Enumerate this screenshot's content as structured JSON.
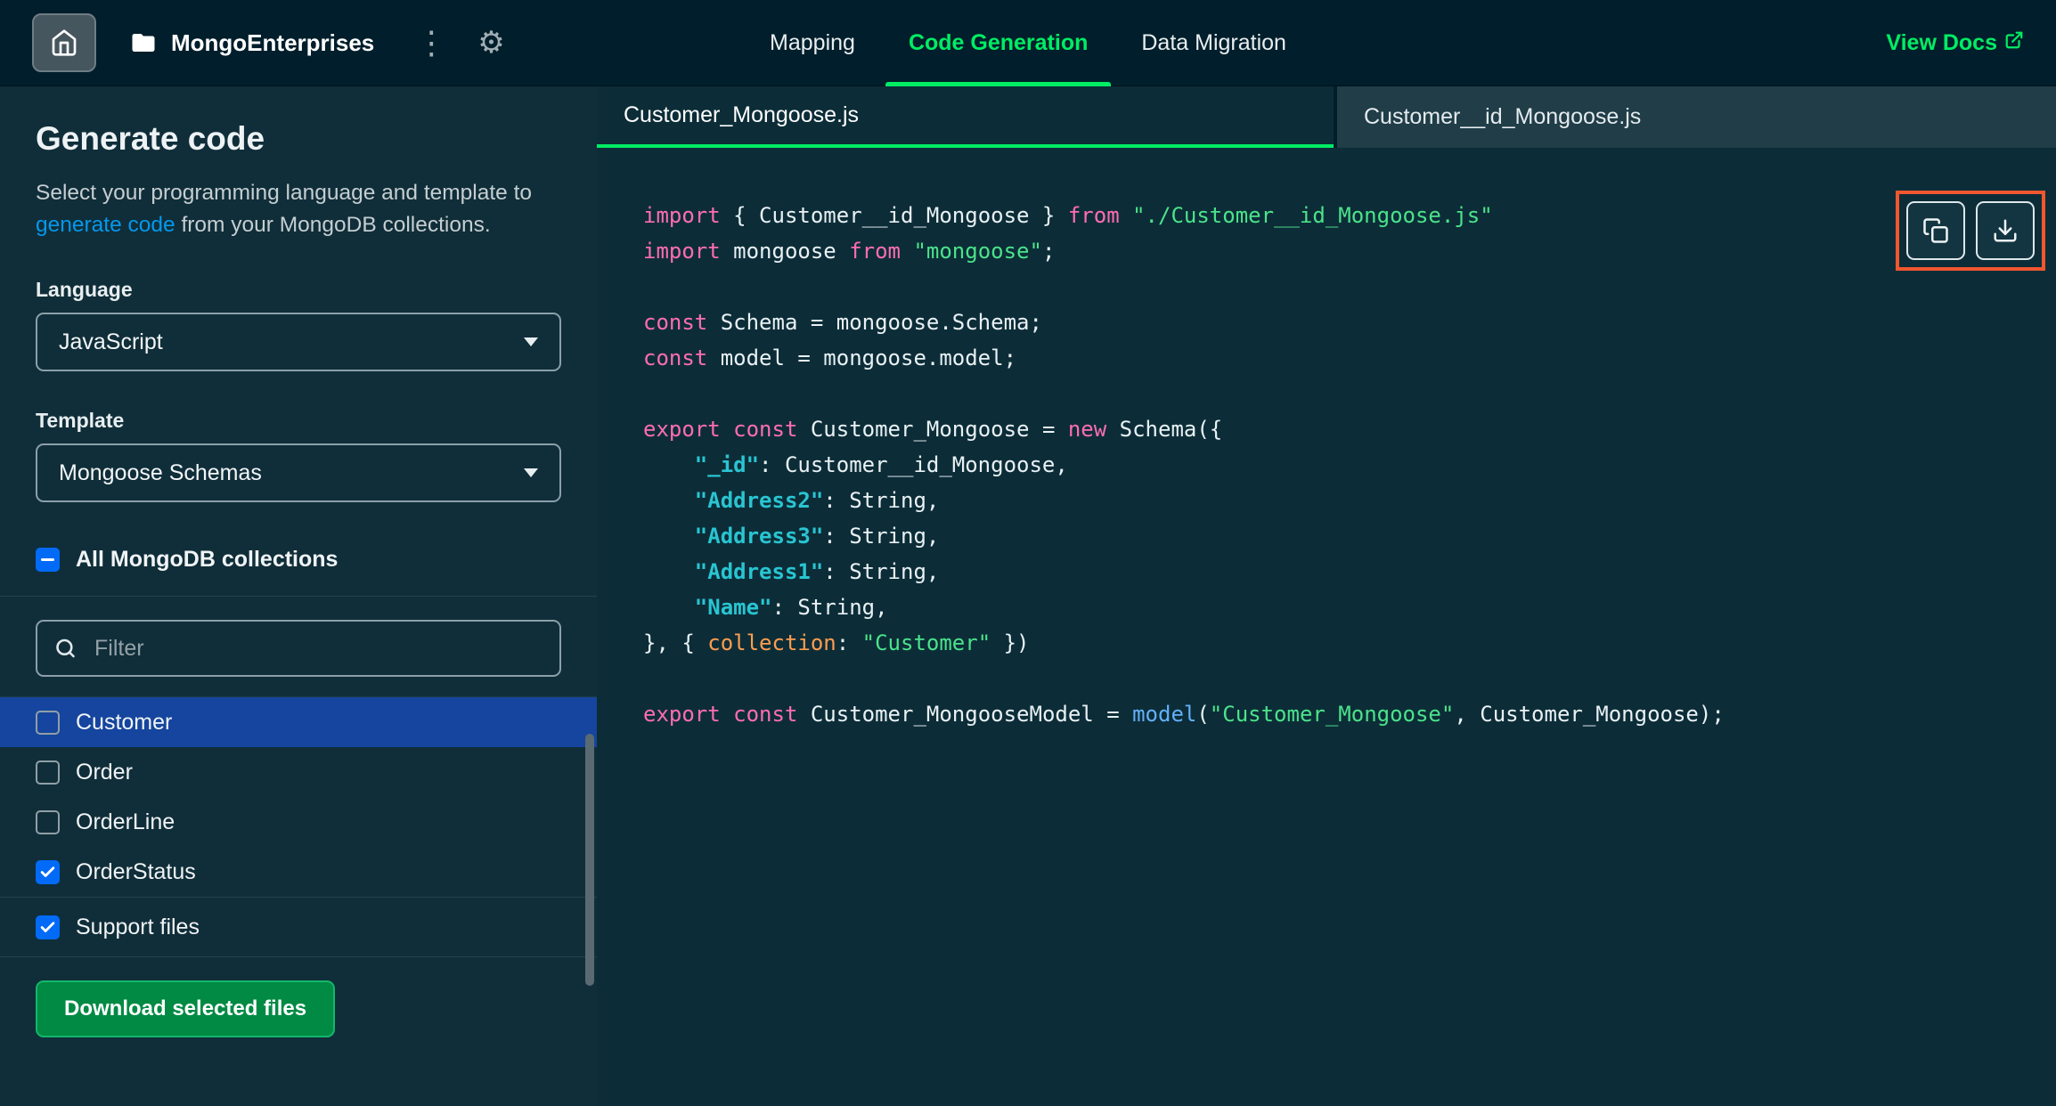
{
  "topbar": {
    "project_name": "MongoEnterprises",
    "tabs": [
      {
        "label": "Mapping",
        "active": false
      },
      {
        "label": "Code Generation",
        "active": true
      },
      {
        "label": "Data Migration",
        "active": false
      }
    ],
    "view_docs_label": "View Docs"
  },
  "sidebar": {
    "title": "Generate code",
    "description_prefix": "Select your programming language and template to ",
    "description_link": "generate code",
    "description_suffix": " from your MongoDB collections.",
    "language_label": "Language",
    "language_value": "JavaScript",
    "template_label": "Template",
    "template_value": "Mongoose Schemas",
    "all_collections_label": "All MongoDB collections",
    "filter_placeholder": "Filter",
    "collections": [
      {
        "name": "Customer",
        "checked": false,
        "selected": true
      },
      {
        "name": "Order",
        "checked": false,
        "selected": false
      },
      {
        "name": "OrderLine",
        "checked": false,
        "selected": false
      },
      {
        "name": "OrderStatus",
        "checked": true,
        "selected": false
      }
    ],
    "support_files": {
      "label": "Support files",
      "checked": true
    },
    "download_button_label": "Download selected files"
  },
  "editor": {
    "tabs": [
      {
        "label": "Customer_Mongoose.js",
        "active": true
      },
      {
        "label": "Customer__id_Mongoose.js",
        "active": false
      }
    ],
    "code_lines": [
      [
        {
          "t": "import",
          "c": "kw"
        },
        {
          "t": " { Customer__id_Mongoose } ",
          "c": "pl"
        },
        {
          "t": "from",
          "c": "kw"
        },
        {
          "t": " ",
          "c": "pl"
        },
        {
          "t": "\"./Customer__id_Mongoose.js\"",
          "c": "str"
        }
      ],
      [
        {
          "t": "import",
          "c": "kw"
        },
        {
          "t": " mongoose ",
          "c": "pl"
        },
        {
          "t": "from",
          "c": "kw"
        },
        {
          "t": " ",
          "c": "pl"
        },
        {
          "t": "\"mongoose\"",
          "c": "str"
        },
        {
          "t": ";",
          "c": "pl"
        }
      ],
      [],
      [
        {
          "t": "const",
          "c": "kw"
        },
        {
          "t": " Schema = mongoose.Schema;",
          "c": "pl"
        }
      ],
      [
        {
          "t": "const",
          "c": "kw"
        },
        {
          "t": " model = mongoose.model;",
          "c": "pl"
        }
      ],
      [],
      [
        {
          "t": "export",
          "c": "kw"
        },
        {
          "t": " ",
          "c": "pl"
        },
        {
          "t": "const",
          "c": "kw"
        },
        {
          "t": " Customer_Mongoose = ",
          "c": "pl"
        },
        {
          "t": "new",
          "c": "kw"
        },
        {
          "t": " Schema({",
          "c": "pl"
        }
      ],
      [
        {
          "t": "    ",
          "c": "pl"
        },
        {
          "t": "\"_id\"",
          "c": "prop"
        },
        {
          "t": ": Customer__id_Mongoose,",
          "c": "pl"
        }
      ],
      [
        {
          "t": "    ",
          "c": "pl"
        },
        {
          "t": "\"Address2\"",
          "c": "prop"
        },
        {
          "t": ": String,",
          "c": "pl"
        }
      ],
      [
        {
          "t": "    ",
          "c": "pl"
        },
        {
          "t": "\"Address3\"",
          "c": "prop"
        },
        {
          "t": ": String,",
          "c": "pl"
        }
      ],
      [
        {
          "t": "    ",
          "c": "pl"
        },
        {
          "t": "\"Address1\"",
          "c": "prop"
        },
        {
          "t": ": String,",
          "c": "pl"
        }
      ],
      [
        {
          "t": "    ",
          "c": "pl"
        },
        {
          "t": "\"Name\"",
          "c": "prop"
        },
        {
          "t": ": String,",
          "c": "pl"
        }
      ],
      [
        {
          "t": "}, { ",
          "c": "pl"
        },
        {
          "t": "collection",
          "c": "attr"
        },
        {
          "t": ": ",
          "c": "pl"
        },
        {
          "t": "\"Customer\"",
          "c": "str"
        },
        {
          "t": " })",
          "c": "pl"
        }
      ],
      [],
      [
        {
          "t": "export",
          "c": "kw"
        },
        {
          "t": " ",
          "c": "pl"
        },
        {
          "t": "const",
          "c": "kw"
        },
        {
          "t": " Customer_MongooseModel = ",
          "c": "pl"
        },
        {
          "t": "model",
          "c": "fn"
        },
        {
          "t": "(",
          "c": "pl"
        },
        {
          "t": "\"Customer_Mongoose\"",
          "c": "str"
        },
        {
          "t": ", Customer_Mongoose);",
          "c": "pl"
        }
      ]
    ]
  },
  "colors": {
    "accent_green": "#00ED64",
    "link_blue": "#0498EC",
    "checkbox_blue": "#016BF8",
    "selected_row_blue": "#15459E",
    "annotation_red": "#F1562F",
    "syntax": {
      "keyword": "#FF6CB5",
      "string": "#4BE38A",
      "property": "#29C5D2",
      "function": "#63B0F9",
      "attribute": "#FF9D4F",
      "plain": "#E9F1F4"
    }
  }
}
